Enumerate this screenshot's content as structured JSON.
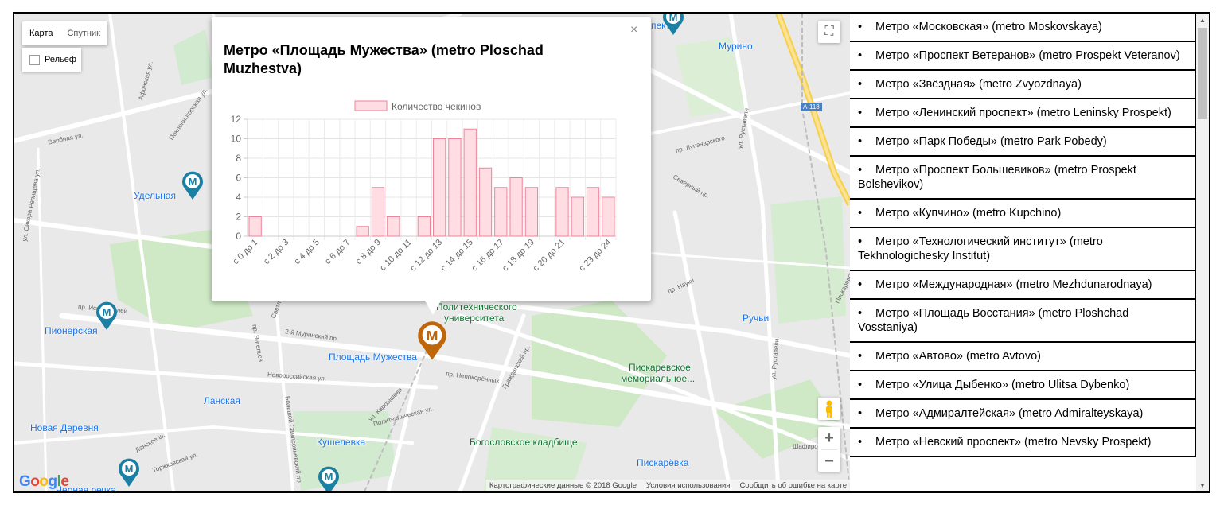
{
  "map": {
    "type_tabs": [
      "Карта",
      "Спутник"
    ],
    "relief_label": "Рельеф",
    "attribution": [
      "Картографические данные © 2018 Google",
      "Условия использования",
      "Сообщить об ошибке на карте"
    ],
    "google_letters": [
      "G",
      "o",
      "o",
      "g",
      "l",
      "e"
    ],
    "zoom_in": "+",
    "zoom_out": "−",
    "fullscreen_glyph": "⛶",
    "labels": [
      {
        "text": "Удельная",
        "cls": ""
      },
      {
        "text": "Пионерская",
        "cls": ""
      },
      {
        "text": "Ланская",
        "cls": ""
      },
      {
        "text": "Новая Деревня",
        "cls": ""
      },
      {
        "text": "Кушелевка",
        "cls": ""
      },
      {
        "text": "Черная речка",
        "cls": ""
      },
      {
        "text": "Площадь Мужества",
        "cls": ""
      },
      {
        "text": "Мурино",
        "cls": ""
      },
      {
        "text": "Ручьи",
        "cls": ""
      },
      {
        "text": "Пискарёвка",
        "cls": ""
      },
      {
        "text": "Богословское кладбище",
        "cls": "green"
      },
      {
        "text": "Пискаревское",
        "cls": "green"
      },
      {
        "text": "мемориальное...",
        "cls": "green"
      },
      {
        "text": "Политехнического",
        "cls": "green"
      },
      {
        "text": "университета",
        "cls": "green"
      },
      {
        "text": "пект",
        "cls": ""
      }
    ],
    "streets": [
      "Вербная ул.",
      "пр. Испытателей",
      "Светл",
      "2-й Муринский пр.",
      "пр. Энгельса",
      "Новороссийская ул.",
      "ул. Карбышева",
      "Политехническая ул.",
      "пр. Непокорённых",
      "Гражданский пр.",
      "пр. Науки",
      "Пискаревский пр.",
      "пр. Луначарского",
      "Северный пр.",
      "ул. Руставели",
      "Поклонногорская ул.",
      "Афонская ул.",
      "Репищева ул.",
      "ул. Сикора",
      "Большой Сампсониевский пр.",
      "Торжковская ул.",
      "Ланское ш.",
      "Шафиро",
      "А-118",
      "ул. Руставели"
    ]
  },
  "popup": {
    "title": "Метро «Площадь Мужества» (metro Ploschad Muzhestva)",
    "close": "×"
  },
  "chart_data": {
    "type": "bar",
    "title": "",
    "legend": "Количество чекинов",
    "xlabel": "",
    "ylabel": "",
    "ylim": [
      0,
      12
    ],
    "yticks": [
      0,
      2,
      4,
      6,
      8,
      10,
      12
    ],
    "categories": [
      "с 0 до 1",
      "с 1 до 2",
      "с 2 до 3",
      "с 3 до 4",
      "с 4 до 5",
      "с 5 до 6",
      "с 6 до 7",
      "с 7 до 8",
      "с 8 до 9",
      "с 9 до 10",
      "с 10 до 11",
      "с 11 до 12",
      "с 12 до 13",
      "с 13 до 14",
      "с 14 до 15",
      "с 15 до 16",
      "с 16 до 17",
      "с 17 до 18",
      "с 18 до 19",
      "с 19 до 20",
      "с 20 до 21",
      "с 21 до 22",
      "с 22 до 23",
      "с 23 до 24"
    ],
    "shown_tick_labels": [
      "с 0 до 1",
      "с 2 до 3",
      "с 4 до 5",
      "с 6 до 7",
      "с 8 до 9",
      "с 10 до 11",
      "с 12 до 13",
      "с 14 до 15",
      "с 16 до 17",
      "с 18 до 19",
      "с 20 до 21",
      "с 23 до 24"
    ],
    "values": [
      2,
      0,
      0,
      0,
      0,
      0,
      0,
      1,
      5,
      2,
      0,
      2,
      10,
      10,
      11,
      7,
      5,
      6,
      5,
      0,
      5,
      4,
      5,
      4
    ],
    "bar_fill": "#ffdde3",
    "bar_stroke": "#f0829a"
  },
  "list": [
    "Метро «Московская» (metro Moskovskaya)",
    "Метро «Проспект Ветеранов» (metro Prospekt Veteranov)",
    "Метро «Звёздная» (metro Zvyozdnaya)",
    "Метро «Ленинский проспект» (metro Leninsky Prospekt)",
    "Метро «Парк Победы» (metro Park Pobedy)",
    "Метро «Проспект Большевиков» (metro Prospekt Bolshevikov)",
    "Метро «Купчино» (metro Kupchino)",
    "Метро «Технологический институт» (metro Tekhnologichesky Institut)",
    "Метро «Международная» (metro Mezhdunarodnaya)",
    "Метро «Площадь Восстания» (metro Ploshchad Vosstaniya)",
    "Метро «Автово» (metro Avtovo)",
    "Метро «Улица Дыбенко» (metro Ulitsa Dybenko)",
    "Метро «Адмиралтейская» (metro Admiralteyskaya)",
    "Метро «Невский проспект» (metro Nevsky Prospekt)"
  ],
  "list_bullet": "•",
  "metro_glyph": "M",
  "colors": {
    "metro_blue": "#1b7fa3",
    "metro_selected": "#c0660a",
    "link": "#1a73e8"
  }
}
